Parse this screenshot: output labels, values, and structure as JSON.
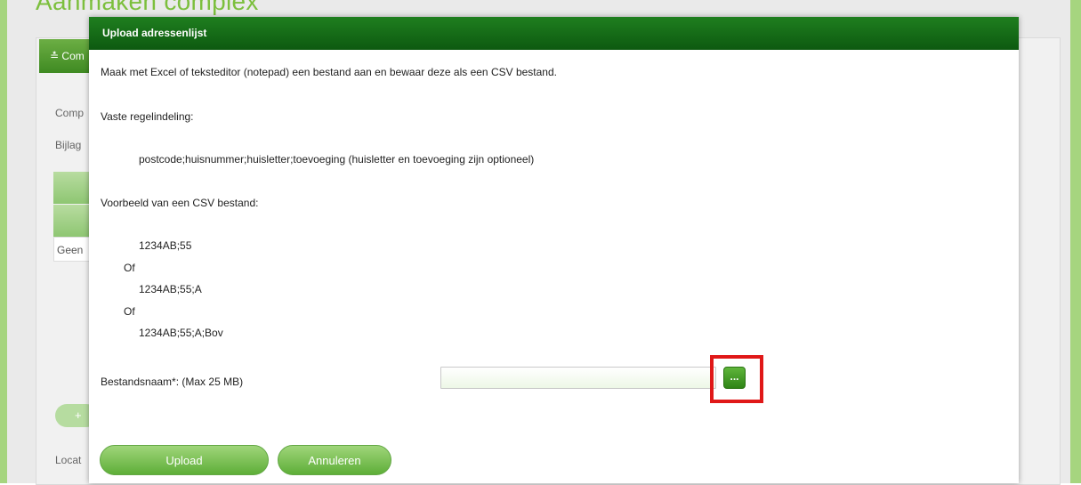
{
  "background": {
    "page_title": "Aanmaken complex",
    "panel_header": "Com",
    "labels": {
      "comp": "Comp",
      "bijlage": "Bijlag",
      "geen": "Geen",
      "locatie": "Locat"
    },
    "plus_button": "+"
  },
  "modal": {
    "title": "Upload adressenlijst",
    "intro": "Maak met Excel of teksteditor (notepad) een bestand aan en bewaar deze als een CSV bestand.",
    "format_heading": "Vaste regelindeling:",
    "format_line": "postcode;huisnummer;huisletter;toevoeging (huisletter en toevoeging zijn optioneel)",
    "example_heading": "Voorbeeld van een CSV bestand:",
    "examples": {
      "ex1": "1234AB;55",
      "or1": "Of",
      "ex2": "1234AB;55;A",
      "or2": "Of",
      "ex3": "1234AB;55;A;Bov"
    },
    "file_label": "Bestandsnaam*: (Max 25 MB)",
    "file_value": "",
    "browse_label": "...",
    "upload_label": "Upload",
    "cancel_label": "Annuleren"
  },
  "colors": {
    "header_green": "#0d5a10",
    "button_green": "#5eae38",
    "highlight_red": "#e01818",
    "side_green": "#a6d57f"
  }
}
